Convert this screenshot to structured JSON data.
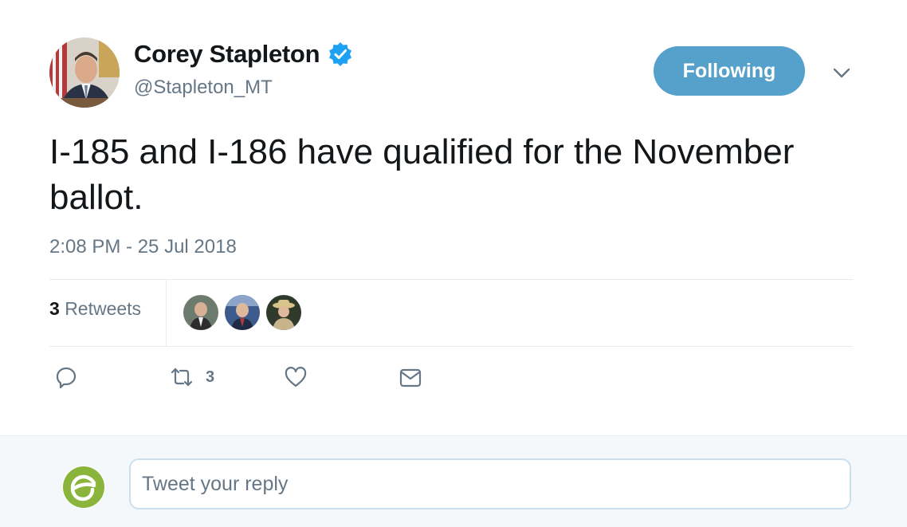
{
  "author": {
    "name": "Corey Stapleton",
    "handle": "@Stapleton_MT",
    "verified": true
  },
  "follow_button": {
    "label": "Following"
  },
  "tweet": {
    "text": "I-185 and I-186 have qualified for the November ballot.",
    "timestamp": "2:08 PM - 25 Jul 2018"
  },
  "stats": {
    "retweet_count": "3",
    "retweet_label": "Retweets"
  },
  "actions": {
    "reply_icon": "reply-icon",
    "retweet_icon": "retweet-icon",
    "retweet_count": "3",
    "like_icon": "heart-icon",
    "dm_icon": "envelope-icon"
  },
  "reply": {
    "placeholder": "Tweet your reply"
  },
  "colors": {
    "accent": "#55a1cc",
    "verified": "#1da1f2",
    "muted": "#657786",
    "text": "#14171a",
    "divider": "#e6ecf0",
    "reply_avatar": "#8ab43c"
  }
}
